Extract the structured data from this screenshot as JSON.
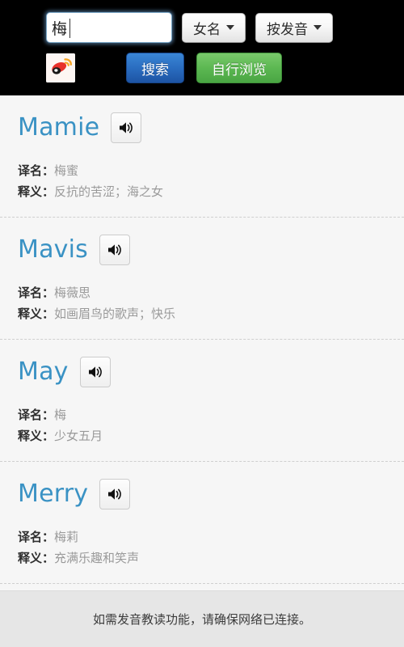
{
  "header": {
    "search": {
      "value": "梅",
      "placeholder": ""
    },
    "dropdowns": [
      {
        "label": "女名",
        "icon": "chevron-down-icon"
      },
      {
        "label": "按发音",
        "icon": "chevron-down-icon"
      }
    ],
    "logo_icon": "weibo-logo-icon",
    "buttons": {
      "search_label": "搜索",
      "browse_label": "自行浏览"
    },
    "colors": {
      "background": "#000000",
      "search_button": "#2a6dc0",
      "browse_button": "#5cb852",
      "focus_glow": "#6ea0d2"
    }
  },
  "results": {
    "label_name": "译名：",
    "label_meaning": "释义：",
    "speaker_icon": "speaker-icon",
    "name_color": "#3a92c4",
    "entries": [
      {
        "name": "Mamie",
        "translated": "梅蜜",
        "meaning": "反抗的苦涩；海之女"
      },
      {
        "name": "Mavis",
        "translated": "梅薇思",
        "meaning": "如画眉鸟的歌声；快乐"
      },
      {
        "name": "May",
        "translated": "梅",
        "meaning": "少女五月"
      },
      {
        "name": "Merry",
        "translated": "梅莉",
        "meaning": "充满乐趣和笑声"
      }
    ]
  },
  "footer": {
    "note": "如需发音教读功能，请确保网络已连接。"
  }
}
